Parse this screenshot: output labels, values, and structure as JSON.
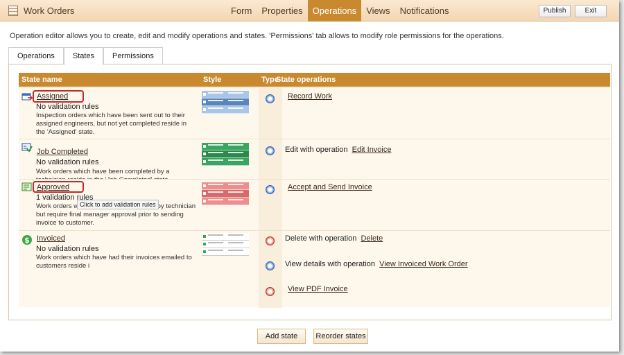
{
  "app": {
    "title": "Work Orders"
  },
  "nav": [
    {
      "label": "Form",
      "active": false
    },
    {
      "label": "Properties",
      "active": false
    },
    {
      "label": "Operations",
      "active": true
    },
    {
      "label": "Views",
      "active": false
    },
    {
      "label": "Notifications",
      "active": false
    }
  ],
  "buttons": {
    "publish": "Publish",
    "exit": "Exit",
    "add_state": "Add state",
    "reorder_states": "Reorder states"
  },
  "description": "Operation editor allows you to create, edit and modify operations and states. 'Permissions' tab allows to modify role permissions for the operations.",
  "tabs": [
    {
      "label": "Operations",
      "active": false
    },
    {
      "label": "States",
      "active": true
    },
    {
      "label": "Permissions",
      "active": false
    }
  ],
  "table": {
    "headers": {
      "state_name": "State name",
      "style": "Style",
      "type": "Type",
      "state_operations": "State operations"
    },
    "rows": [
      {
        "name": "Assigned",
        "validation": "No validation rules",
        "description": "Inspection orders which have been sent out to their assigned engineers, but not yet completed reside in the 'Assigned' state.",
        "icon": "assigned-icon",
        "style_color": "#a9c6e6",
        "operations": [
          {
            "prefix": "",
            "link": "Record Work",
            "icon": "arrow-circle-icon"
          }
        ]
      },
      {
        "name": "Job Completed",
        "validation": "No validation rules",
        "description": "Work orders which have been completed by a technician reside in the 'Job Completed' state.",
        "icon": "job-completed-icon",
        "style_color": "#3aa560",
        "operations": [
          {
            "prefix": "Edit with operation",
            "link": "Edit Invoice",
            "icon": "edit-circle-icon"
          }
        ]
      },
      {
        "name": "Approved",
        "validation": "1 validation rules",
        "description": "Work orders which have been completed by technician but require final manager approval prior to sending invoice to customer.",
        "icon": "approved-icon",
        "style_color": "#ee8d8d",
        "operations": [
          {
            "prefix": "",
            "link": "Accept and Send Invoice",
            "icon": "arrow-circle-icon"
          }
        ]
      },
      {
        "name": "Invoiced",
        "validation": "No validation rules",
        "description": "Work orders which have had their invoices emailed to customers reside i",
        "icon": "dollar-icon",
        "style_color": "#ffffff",
        "operations": [
          {
            "prefix": "Delete with operation",
            "link": "Delete",
            "icon": "delete-circle-icon"
          },
          {
            "prefix": "View details with operation",
            "link": "View Invoiced Work Order",
            "icon": "view-circle-icon"
          },
          {
            "prefix": "",
            "link": "View PDF Invoice",
            "icon": "pdf-circle-icon"
          }
        ]
      }
    ]
  },
  "tooltip": "Click to add validation rules"
}
